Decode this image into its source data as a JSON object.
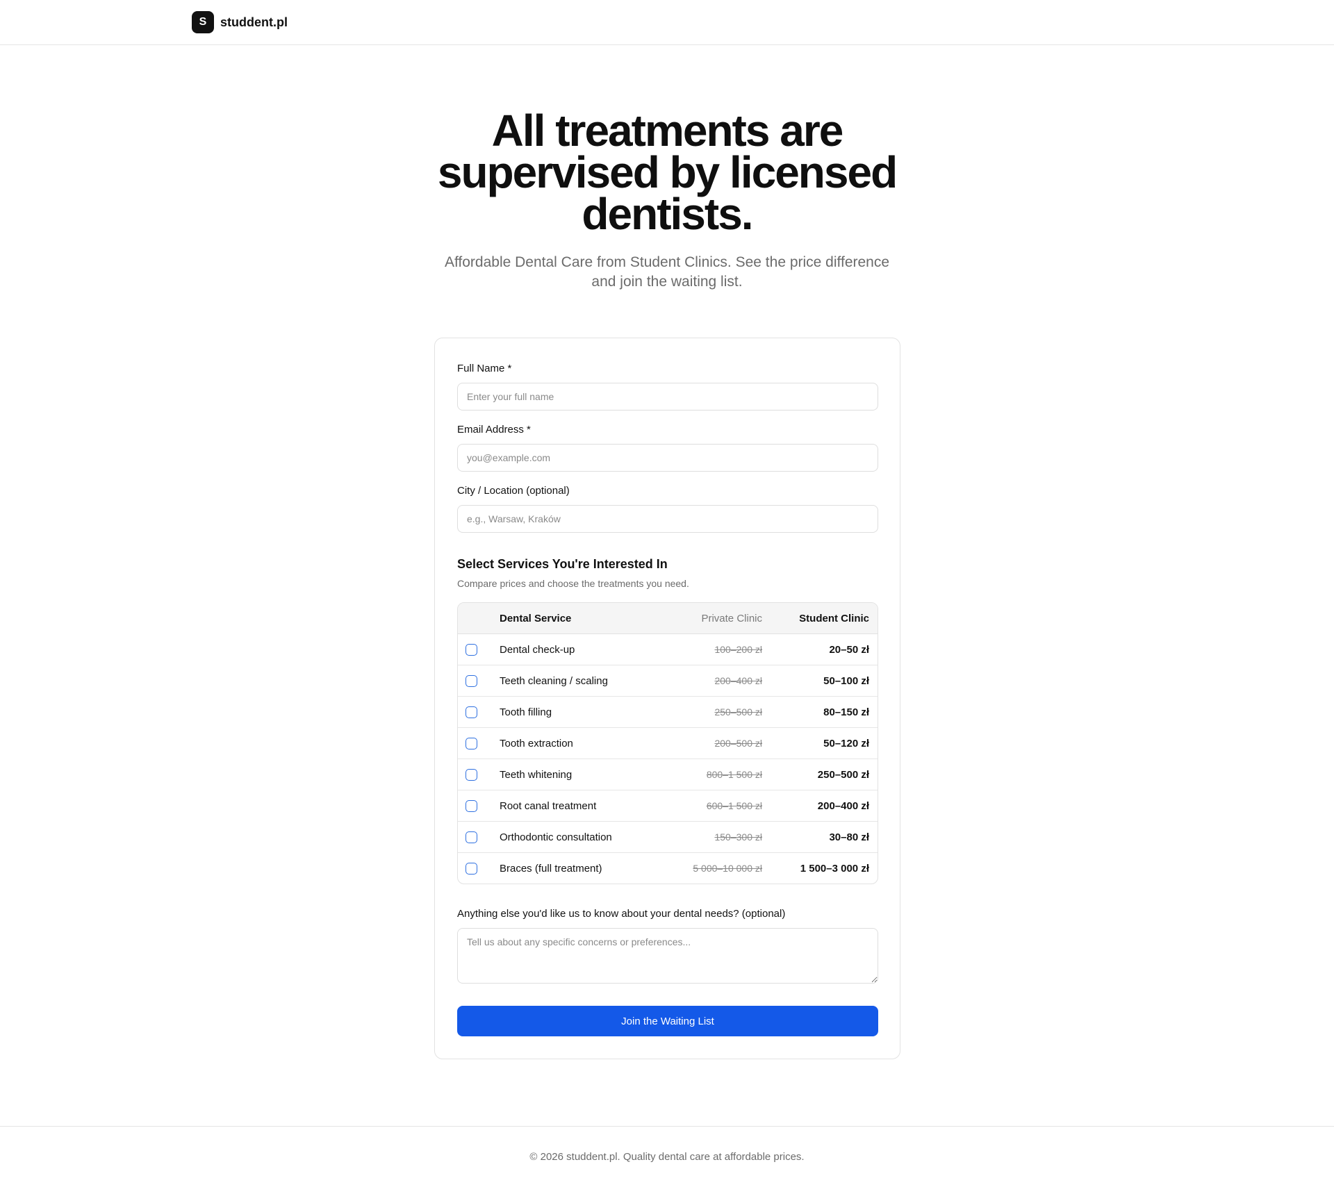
{
  "brand": {
    "logo_letter": "S",
    "name": "studdent.pl"
  },
  "hero": {
    "title": "All treatments are supervised by licensed dentists.",
    "subtitle": "Affordable Dental Care from Student Clinics. See the price difference and join the waiting list."
  },
  "form": {
    "full_name": {
      "label": "Full Name *",
      "placeholder": "Enter your full name",
      "value": ""
    },
    "email": {
      "label": "Email Address *",
      "placeholder": "you@example.com",
      "value": ""
    },
    "city": {
      "label": "City / Location (optional)",
      "placeholder": "e.g., Warsaw, Kraków",
      "value": ""
    },
    "services": {
      "title": "Select Services You're Interested In",
      "subtitle": "Compare prices and choose the treatments you need.",
      "columns": {
        "service": "Dental Service",
        "private": "Private Clinic",
        "student": "Student Clinic"
      },
      "rows": [
        {
          "name": "Dental check-up",
          "private": "100–200 zł",
          "student": "20–50 zł",
          "checked": false
        },
        {
          "name": "Teeth cleaning / scaling",
          "private": "200–400 zł",
          "student": "50–100 zł",
          "checked": false
        },
        {
          "name": "Tooth filling",
          "private": "250–500 zł",
          "student": "80–150 zł",
          "checked": false
        },
        {
          "name": "Tooth extraction",
          "private": "200–500 zł",
          "student": "50–120 zł",
          "checked": false
        },
        {
          "name": "Teeth whitening",
          "private": "800–1 500 zł",
          "student": "250–500 zł",
          "checked": false
        },
        {
          "name": "Root canal treatment",
          "private": "600–1 500 zł",
          "student": "200–400 zł",
          "checked": false
        },
        {
          "name": "Orthodontic consultation",
          "private": "150–300 zł",
          "student": "30–80 zł",
          "checked": false
        },
        {
          "name": "Braces (full treatment)",
          "private": "5 000–10 000 zł",
          "student": "1 500–3 000 zł",
          "checked": false
        }
      ]
    },
    "notes": {
      "label": "Anything else you'd like us to know about your dental needs? (optional)",
      "placeholder": "Tell us about any specific concerns or preferences...",
      "value": ""
    },
    "submit_label": "Join the Waiting List"
  },
  "footer": {
    "text": "© 2026 studdent.pl. Quality dental care at affordable prices."
  },
  "colors": {
    "accent": "#1459e8",
    "checkbox_border": "#2d6fe0",
    "text": "#111111",
    "muted": "#6b6b6b"
  }
}
